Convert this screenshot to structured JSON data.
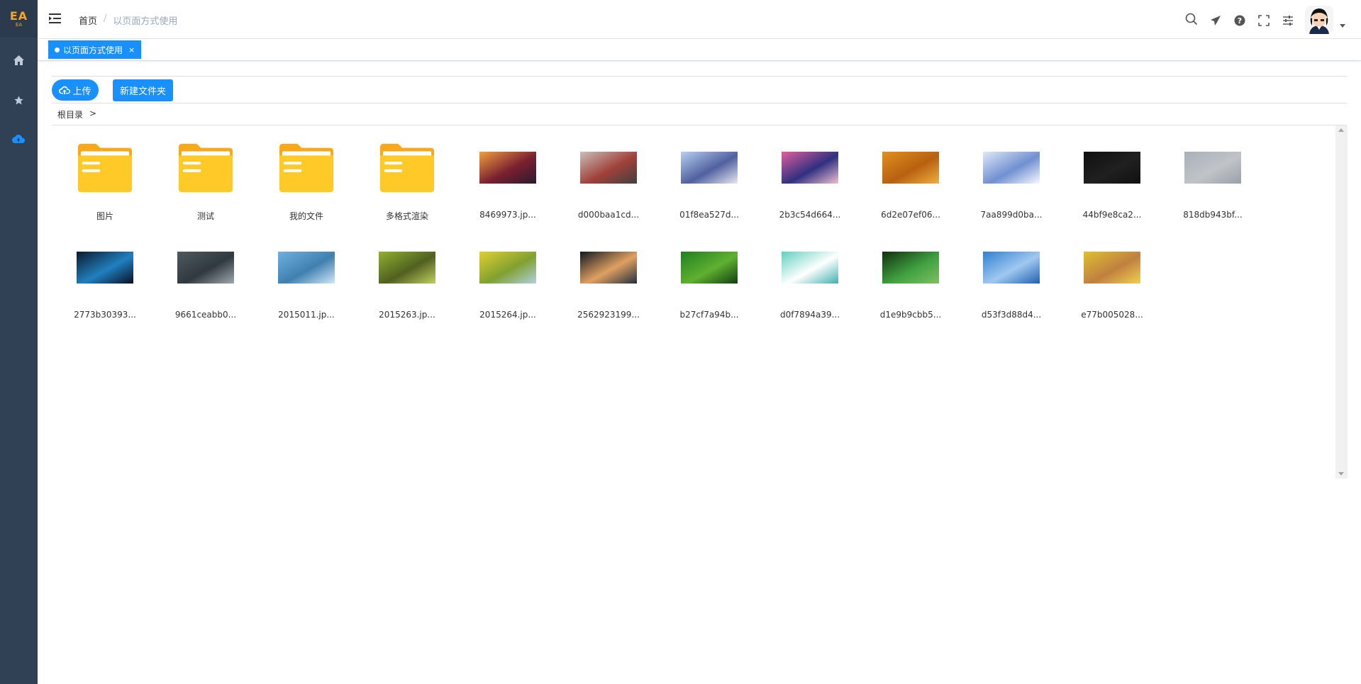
{
  "sidebar": {
    "logo_main": "EA",
    "logo_sub": "EA",
    "items": [
      {
        "icon": "home-icon"
      },
      {
        "icon": "star-icon"
      },
      {
        "icon": "cloud-upload-icon"
      }
    ],
    "active_color": "#1890ff",
    "background": "#304156"
  },
  "header": {
    "breadcrumb": {
      "home": "首页",
      "separator": "/",
      "current": "以页面方式使用"
    },
    "icons": [
      "search-icon",
      "send-icon",
      "help-icon",
      "fullscreen-icon",
      "settings-sliders-icon"
    ]
  },
  "tags": [
    {
      "label": "以页面方式使用",
      "close": "×",
      "active": true
    }
  ],
  "toolbar": {
    "upload_label": "上传",
    "new_folder_label": "新建文件夹"
  },
  "path": {
    "root": "根目录",
    "separator": ">"
  },
  "files": [
    {
      "name": "图片",
      "type": "folder"
    },
    {
      "name": "测试",
      "type": "folder"
    },
    {
      "name": "我的文件",
      "type": "folder"
    },
    {
      "name": "多格式渲染",
      "type": "folder"
    },
    {
      "name": "8469973.jp...",
      "type": "image",
      "colors": [
        "#f0a040",
        "#7a2030",
        "#2a1a30"
      ]
    },
    {
      "name": "d000baa1cd...",
      "type": "image",
      "colors": [
        "#c8c0b8",
        "#a0413a",
        "#404040"
      ]
    },
    {
      "name": "01f8ea527d...",
      "type": "image",
      "colors": [
        "#b8d0f0",
        "#5060a0",
        "#e8e8f0"
      ]
    },
    {
      "name": "2b3c54d664...",
      "type": "image",
      "colors": [
        "#e060a0",
        "#303080",
        "#f0c0d0"
      ]
    },
    {
      "name": "6d2e07ef06...",
      "type": "image",
      "colors": [
        "#e09020",
        "#b86010",
        "#f0b040"
      ]
    },
    {
      "name": "7aa899d0ba...",
      "type": "image",
      "colors": [
        "#e0e8f8",
        "#7090d0",
        "#f8f8ff"
      ]
    },
    {
      "name": "44bf9e8ca2...",
      "type": "image",
      "colors": [
        "#101010",
        "#202020",
        "#101010"
      ]
    },
    {
      "name": "818db943bf...",
      "type": "image",
      "colors": [
        "#a8b0b8",
        "#c0c4c8",
        "#9aa0a8"
      ]
    },
    {
      "name": "2773b30393...",
      "type": "image",
      "colors": [
        "#0a1a2a",
        "#2080c0",
        "#0a1020"
      ]
    },
    {
      "name": "9661ceabb0...",
      "type": "image",
      "colors": [
        "#505860",
        "#303840",
        "#a0a8b0"
      ]
    },
    {
      "name": "2015011.jp...",
      "type": "image",
      "colors": [
        "#70b0e0",
        "#4080b0",
        "#d0e8f8"
      ]
    },
    {
      "name": "2015263.jp...",
      "type": "image",
      "colors": [
        "#90b030",
        "#506020",
        "#c0d060"
      ]
    },
    {
      "name": "2015264.jp...",
      "type": "image",
      "colors": [
        "#e0d030",
        "#80a030",
        "#b0d0e0"
      ]
    },
    {
      "name": "2562923199...",
      "type": "image",
      "colors": [
        "#101820",
        "#e0a060",
        "#203040"
      ]
    },
    {
      "name": "b27cf7a94b...",
      "type": "image",
      "colors": [
        "#208020",
        "#60b030",
        "#104010"
      ]
    },
    {
      "name": "d0f7894a39...",
      "type": "image",
      "colors": [
        "#60d0c0",
        "#ffffff",
        "#40b0b0"
      ]
    },
    {
      "name": "d1e9b9cbb5...",
      "type": "image",
      "colors": [
        "#103010",
        "#40a040",
        "#80c060"
      ]
    },
    {
      "name": "d53f3d88d4...",
      "type": "image",
      "colors": [
        "#3080d0",
        "#a0c8f0",
        "#2060b0"
      ]
    },
    {
      "name": "e77b005028...",
      "type": "image",
      "colors": [
        "#e0c030",
        "#c08040",
        "#f0d050"
      ]
    }
  ]
}
